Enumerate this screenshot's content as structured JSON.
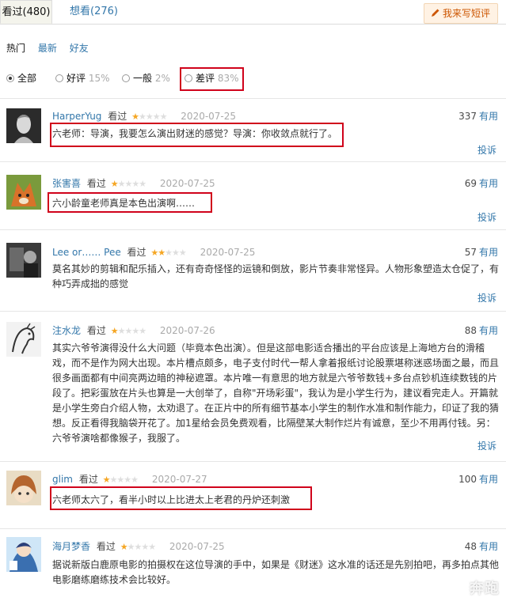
{
  "tabs": {
    "watched": "看过(480)",
    "want": "想看(276)",
    "write_button": "我来写短评"
  },
  "sort": {
    "hot": "热门",
    "latest": "最新",
    "friends": "好友"
  },
  "filters": [
    {
      "label": "全部",
      "pct": "",
      "selected": true
    },
    {
      "label": "好评",
      "pct": "15%",
      "selected": false
    },
    {
      "label": "一般",
      "pct": "2%",
      "selected": false
    },
    {
      "label": "差评",
      "pct": "83%",
      "selected": false
    }
  ],
  "comments": [
    {
      "user": "HarperYug",
      "status": "看过",
      "rating": 1,
      "date": "2020-07-25",
      "votes": "337",
      "useful": "有用",
      "text": "六老师：导演，我要怎么演出财迷的感觉？导演：你收敛点就行了。",
      "report": "投诉"
    },
    {
      "user": "张害喜",
      "status": "看过",
      "rating": 1,
      "date": "2020-07-25",
      "votes": "69",
      "useful": "有用",
      "text": "六小龄童老师真是本色出演啊……",
      "report": "投诉"
    },
    {
      "user": "Lee or…… Pee",
      "status": "看过",
      "rating": 2,
      "date": "2020-07-25",
      "votes": "57",
      "useful": "有用",
      "text": "莫名其妙的剪辑和配乐插入，还有奇奇怪怪的运镜和倒放，影片节奏非常怪异。人物形象塑造太仓促了，有种巧弄成拙的感觉",
      "report": "投诉"
    },
    {
      "user": "注水龙",
      "status": "看过",
      "rating": 1,
      "date": "2020-07-26",
      "votes": "88",
      "useful": "有用",
      "text": "其实六爷爷演得没什么大问题（毕竟本色出演）。但是这部电影适合播出的平台应该是上海地方台的滑稽戏，而不是作为网大出现。本片槽点颇多，电子支付时代一帮人拿着报纸讨论股票堪称迷惑场面之最，而且很多画面都有中间亮两边暗的神秘遮罩。本片唯一有意思的地方就是六爷爷数钱+多台点钞机连续数钱的片段了。把彩蛋放在片头也算是一大创举了，自称\"开场彩蛋\"，我认为是小学生行为，建议看完走人。开篇就是小学生旁白介绍人物，太劝退了。在正片中的所有细节基本小学生的制作水准和制作能力，印证了我的猜想。反正看得我脑袋开花了。加1星给会员免费观看，比隔壁某大制作烂片有诚意，至少不用再付钱。另：六爷爷演啥都像猴子，我服了。",
      "report": "投诉"
    },
    {
      "user": "glim",
      "status": "看过",
      "rating": 1,
      "date": "2020-07-27",
      "votes": "100",
      "useful": "有用",
      "text": "六老师太六了，看半小时以上比进太上老君的丹炉还刺激",
      "report": ""
    },
    {
      "user": "海月梦香",
      "status": "看过",
      "rating": 1,
      "date": "2020-07-25",
      "votes": "48",
      "useful": "有用",
      "text": "据说新版白鹿原电影的拍摄权在这位导演的手中，如果是《财迷》这水准的话还是先别拍吧，再多拍点其他电影磨练磨练技术会比较好。",
      "report": ""
    }
  ],
  "watermark": "奔跑",
  "colors": {
    "link": "#3377aa",
    "highlight_box": "#d0021b",
    "star": "#f5a623",
    "button_text": "#cc5500"
  }
}
